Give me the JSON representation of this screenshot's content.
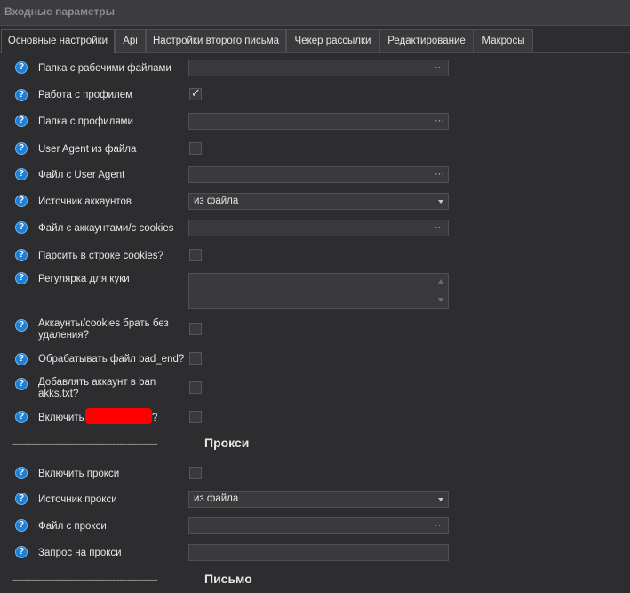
{
  "window": {
    "title": "Входные параметры"
  },
  "tabs": [
    {
      "label": "Основные настройки",
      "active": true
    },
    {
      "label": "Api",
      "active": false
    },
    {
      "label": "Настройки второго письма",
      "active": false
    },
    {
      "label": "Чекер рассылки",
      "active": false
    },
    {
      "label": "Редактирование",
      "active": false
    },
    {
      "label": "Макросы",
      "active": false
    }
  ],
  "help_glyph": "?",
  "browse_glyph": "···",
  "fields": {
    "work_folder": {
      "label": "Папка с рабочими файлами",
      "value": ""
    },
    "profile_work": {
      "label": "Работа с профилем",
      "checked": true
    },
    "profiles_folder": {
      "label": "Папка с профилями",
      "value": ""
    },
    "ua_from_file": {
      "label": "User Agent из файла",
      "checked": false
    },
    "ua_file": {
      "label": "Файл с User Agent",
      "value": ""
    },
    "accounts_source": {
      "label": "Источник аккаунтов",
      "value": "из файла"
    },
    "accounts_file": {
      "label": "Файл с аккаунтами/с cookies",
      "value": ""
    },
    "parse_cookies": {
      "label": "Парсить в строке cookies?",
      "checked": false
    },
    "cookie_regex": {
      "label": "Регулярка для куки",
      "value": ""
    },
    "take_no_delete": {
      "label": "Аккаунты/cookies брать без удаления?",
      "checked": false
    },
    "process_bad_end": {
      "label": "Обрабатывать файл bad_end?",
      "checked": false
    },
    "add_to_ban": {
      "label": "Добавлять аккаунт в ban akks.txt?",
      "checked": false
    },
    "enable_redacted": {
      "label_prefix": "Включить",
      "label_suffix": "?",
      "checked": false
    }
  },
  "sections": {
    "proxy": {
      "dashes": "--------------------------------------------------------------------",
      "name": "Прокси"
    },
    "letter": {
      "dashes": "--------------------------------------------------------------------",
      "name": "Письмо"
    }
  },
  "proxy_fields": {
    "enable_proxy": {
      "label": "Включить прокси",
      "checked": false
    },
    "proxy_source": {
      "label": "Источник прокси",
      "value": "из файла"
    },
    "proxy_file": {
      "label": "Файл с прокси",
      "value": ""
    },
    "proxy_request": {
      "label": "Запрос на прокси",
      "value": ""
    }
  },
  "colors": {
    "accent": "#1e7fd6",
    "background": "#2d2d30",
    "redaction": "#ff0000"
  }
}
